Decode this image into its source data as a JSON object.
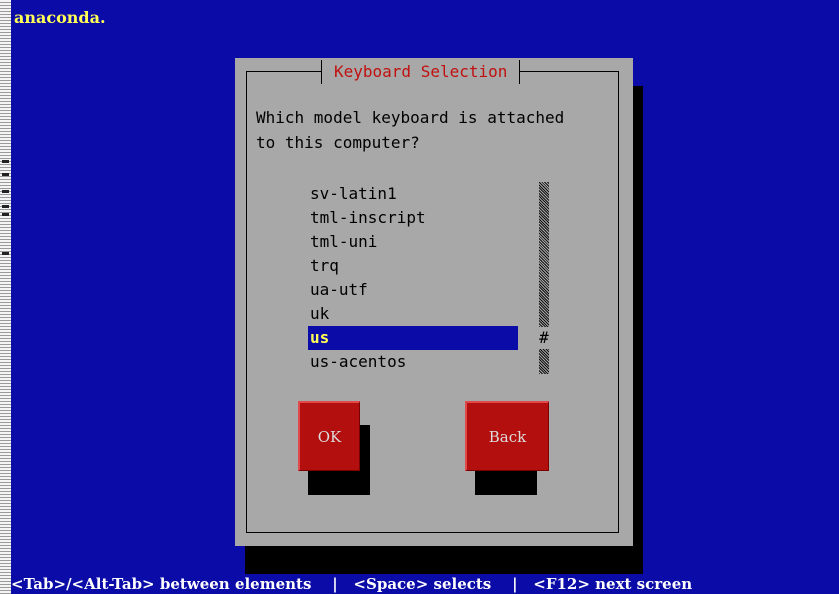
{
  "app": {
    "title": "anaconda."
  },
  "dialog": {
    "title": "Keyboard Selection",
    "question": "Which model keyboard is attached\nto this computer?",
    "keyboard_list": [
      {
        "label": "sv-latin1"
      },
      {
        "label": "tml-inscript"
      },
      {
        "label": "tml-uni"
      },
      {
        "label": "trq"
      },
      {
        "label": "ua-utf"
      },
      {
        "label": "uk"
      },
      {
        "label": "us",
        "selected": true
      },
      {
        "label": "us-acentos"
      }
    ],
    "scroll_marker": "#",
    "buttons": {
      "ok": "OK",
      "back": "Back"
    }
  },
  "status_bar": {
    "text": "<Tab>/<Alt-Tab> between elements    |   <Space> selects    |   <F12> next screen"
  },
  "colors": {
    "background": "#0b0ba8",
    "dialog": "#a8a8a8",
    "title_text": "#c01010",
    "selection": "#0b0ba8",
    "selection_text": "#ffff55",
    "button": "#b40f0f"
  }
}
